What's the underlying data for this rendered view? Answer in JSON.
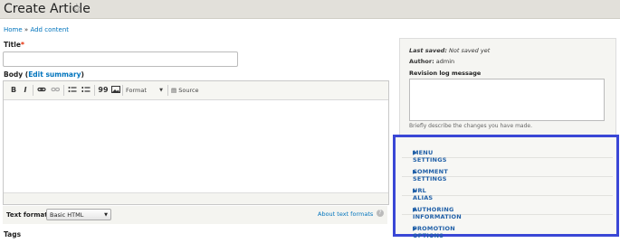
{
  "header": {
    "title": "Create Article",
    "star_icon": "star-icon"
  },
  "breadcrumb": {
    "home": "Home",
    "separator": "»",
    "current": "Add content"
  },
  "form": {
    "title_label": "Title",
    "required_marker": "*",
    "body_label": "Body",
    "edit_summary_link": "Edit summary",
    "toolbar": {
      "bold": "B",
      "italic": "I",
      "link": "link-icon",
      "unlink": "unlink-icon",
      "bullet_list": "bulleted-list-icon",
      "numbered_list": "numbered-list-icon",
      "blockquote": "99",
      "image": "image-icon",
      "format_label": "Format",
      "source_label": "Source"
    },
    "text_format_label": "Text format",
    "text_format_value": "Basic HTML",
    "about_text_formats": "About text formats",
    "tags_label": "Tags"
  },
  "sidebar": {
    "last_saved_label": "Last saved:",
    "last_saved_value": "Not saved yet",
    "author_label": "Author:",
    "author_value": "admin",
    "revision_label": "Revision log message",
    "revision_hint": "Briefly describe the changes you have made.",
    "accordion": [
      {
        "label": "MENU SETTINGS"
      },
      {
        "label": "COMMENT SETTINGS"
      },
      {
        "label": "URL ALIAS"
      },
      {
        "label": "AUTHORING INFORMATION"
      },
      {
        "label": "PROMOTION OPTIONS"
      }
    ]
  },
  "colors": {
    "highlight_border": "#3a47d6",
    "link": "#0074bd",
    "header_bg": "#e2e0da"
  }
}
